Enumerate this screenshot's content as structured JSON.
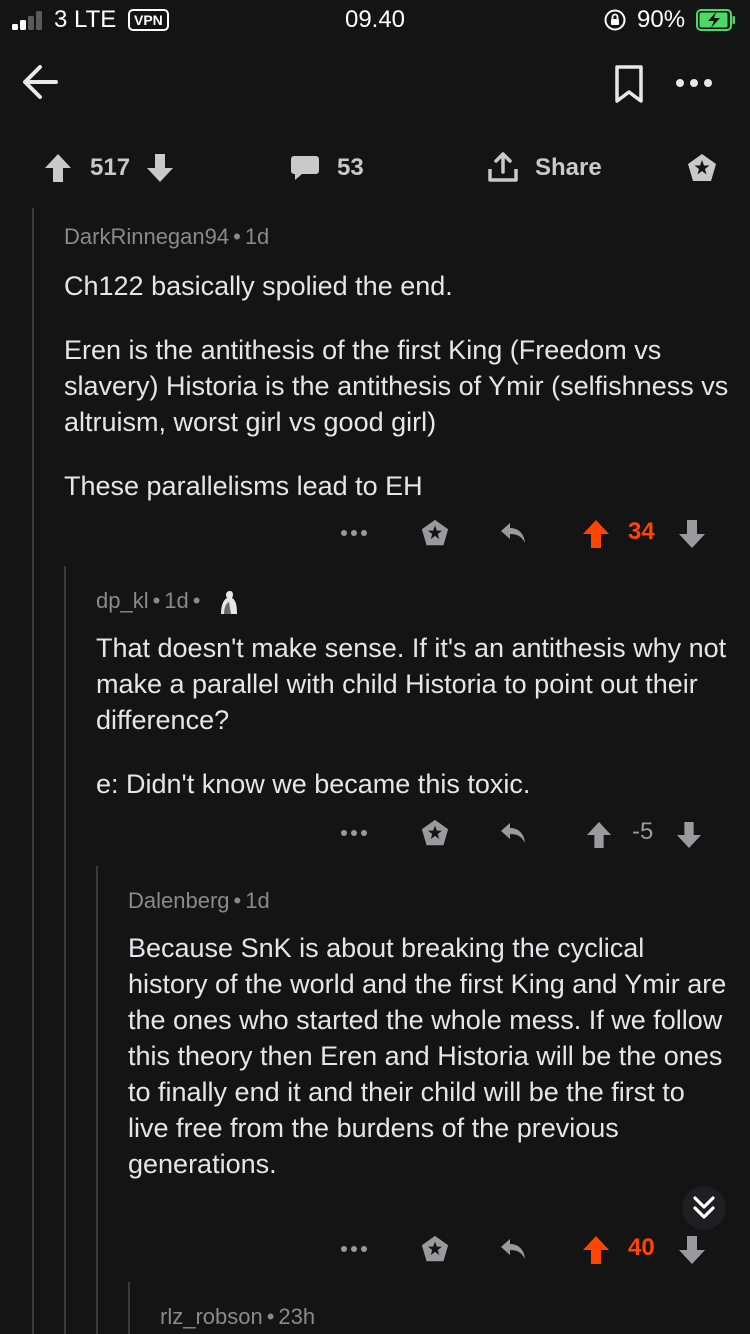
{
  "status_bar": {
    "carrier": "3 LTE",
    "vpn": "VPN",
    "time": "09.40",
    "battery": "90%"
  },
  "post_actions": {
    "upvotes": "517",
    "comments": "53",
    "share_label": "Share"
  },
  "comments": [
    {
      "author": "DarkRinnegan94",
      "age": "1d",
      "paragraphs": [
        "Ch122 basically spolied the end.",
        "Eren is the antithesis of the first King (Freedom vs slavery) Historia is the antithesis of Ymir (selfishness vs altruism, worst girl vs good girl)",
        "These parallelisms lead to EH"
      ],
      "score": "34",
      "vote_state": "up"
    },
    {
      "author": "dp_kl",
      "age": "1d",
      "paragraphs": [
        "That doesn't make sense. If it's an antithesis why not make a parallel with child Historia to point out their difference?",
        "e: Didn't know we became this toxic."
      ],
      "score": "-5",
      "vote_state": "none"
    },
    {
      "author": "Dalenberg",
      "age": "1d",
      "paragraphs": [
        "Because SnK is about breaking the cyclical history of the world and the first King and Ymir are the ones who started the whole mess. If we follow this theory then Eren and Historia will be the ones to finally end it and their child will be the first to live free from the burdens of the previous generations."
      ],
      "score": "40",
      "vote_state": "up"
    },
    {
      "author": "rlz_robson",
      "age": "23h"
    }
  ],
  "colors": {
    "background": "#141414",
    "upvote": "#ff4500",
    "text": "#e6e6e8",
    "meta": "#8a8a8c"
  },
  "icons": [
    "back-arrow-icon",
    "bookmark-icon",
    "more-icon",
    "upvote-icon",
    "downvote-icon",
    "comment-icon",
    "share-icon",
    "award-icon",
    "reply-icon",
    "scroll-down-icon"
  ]
}
